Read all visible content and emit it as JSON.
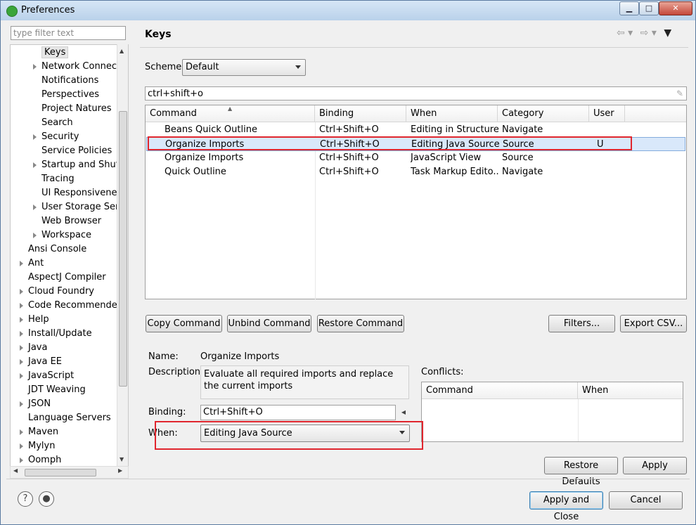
{
  "window": {
    "title": "Preferences"
  },
  "filter": {
    "placeholder": "type filter text"
  },
  "tree": {
    "items": [
      {
        "label": "Keys",
        "indent": 2,
        "arrow": false,
        "selected": true
      },
      {
        "label": "Network Connecti",
        "indent": 2,
        "arrow": true
      },
      {
        "label": "Notifications",
        "indent": 2,
        "arrow": false
      },
      {
        "label": "Perspectives",
        "indent": 2,
        "arrow": false
      },
      {
        "label": "Project Natures",
        "indent": 2,
        "arrow": false
      },
      {
        "label": "Search",
        "indent": 2,
        "arrow": false
      },
      {
        "label": "Security",
        "indent": 2,
        "arrow": true
      },
      {
        "label": "Service Policies",
        "indent": 2,
        "arrow": false
      },
      {
        "label": "Startup and Shutd",
        "indent": 2,
        "arrow": true
      },
      {
        "label": "Tracing",
        "indent": 2,
        "arrow": false
      },
      {
        "label": "UI Responsiveness",
        "indent": 2,
        "arrow": false
      },
      {
        "label": "User Storage Serv",
        "indent": 2,
        "arrow": true
      },
      {
        "label": "Web Browser",
        "indent": 2,
        "arrow": false
      },
      {
        "label": "Workspace",
        "indent": 2,
        "arrow": true
      },
      {
        "label": "Ansi Console",
        "indent": 1,
        "arrow": false
      },
      {
        "label": "Ant",
        "indent": 1,
        "arrow": true
      },
      {
        "label": "AspectJ Compiler",
        "indent": 1,
        "arrow": false
      },
      {
        "label": "Cloud Foundry",
        "indent": 1,
        "arrow": true
      },
      {
        "label": "Code Recommenders",
        "indent": 1,
        "arrow": true
      },
      {
        "label": "Help",
        "indent": 1,
        "arrow": true
      },
      {
        "label": "Install/Update",
        "indent": 1,
        "arrow": true
      },
      {
        "label": "Java",
        "indent": 1,
        "arrow": true
      },
      {
        "label": "Java EE",
        "indent": 1,
        "arrow": true
      },
      {
        "label": "JavaScript",
        "indent": 1,
        "arrow": true
      },
      {
        "label": "JDT Weaving",
        "indent": 1,
        "arrow": false
      },
      {
        "label": "JSON",
        "indent": 1,
        "arrow": true
      },
      {
        "label": "Language Servers",
        "indent": 1,
        "arrow": false
      },
      {
        "label": "Maven",
        "indent": 1,
        "arrow": true
      },
      {
        "label": "Mylyn",
        "indent": 1,
        "arrow": true
      },
      {
        "label": "Oomph",
        "indent": 1,
        "arrow": true
      }
    ]
  },
  "page": {
    "title": "Keys",
    "scheme_label": "Scheme:",
    "scheme_value": "Default",
    "search_value": "ctrl+shift+o"
  },
  "table": {
    "columns": [
      "Command",
      "Binding",
      "When",
      "Category",
      "User"
    ],
    "rows": [
      [
        "Beans Quick Outline",
        "Ctrl+Shift+O",
        "Editing in Structure...",
        "Navigate",
        ""
      ],
      [
        "Organize Imports",
        "Ctrl+Shift+O",
        "Editing Java Source",
        "Source",
        "U"
      ],
      [
        "Organize Imports",
        "Ctrl+Shift+O",
        "JavaScript View",
        "Source",
        ""
      ],
      [
        "Quick Outline",
        "Ctrl+Shift+O",
        "Task Markup Edito...",
        "Navigate",
        ""
      ]
    ],
    "selected_row": 1
  },
  "buttons": {
    "copy": "Copy Command",
    "unbind": "Unbind Command",
    "restore": "Restore Command",
    "filters": "Filters...",
    "export": "Export CSV...",
    "restore_defaults": "Restore Defaults",
    "apply": "Apply",
    "apply_close": "Apply and Close",
    "cancel": "Cancel"
  },
  "details": {
    "name_label": "Name:",
    "name_value": "Organize Imports",
    "desc_label": "Description:",
    "desc_value": "Evaluate all required imports and replace the current imports",
    "binding_label": "Binding:",
    "binding_value": "Ctrl+Shift+O",
    "when_label": "When:",
    "when_value": "Editing Java Source"
  },
  "conflicts": {
    "label": "Conflicts:",
    "columns": [
      "Command",
      "When"
    ]
  },
  "highlight_color": "#e0262e"
}
